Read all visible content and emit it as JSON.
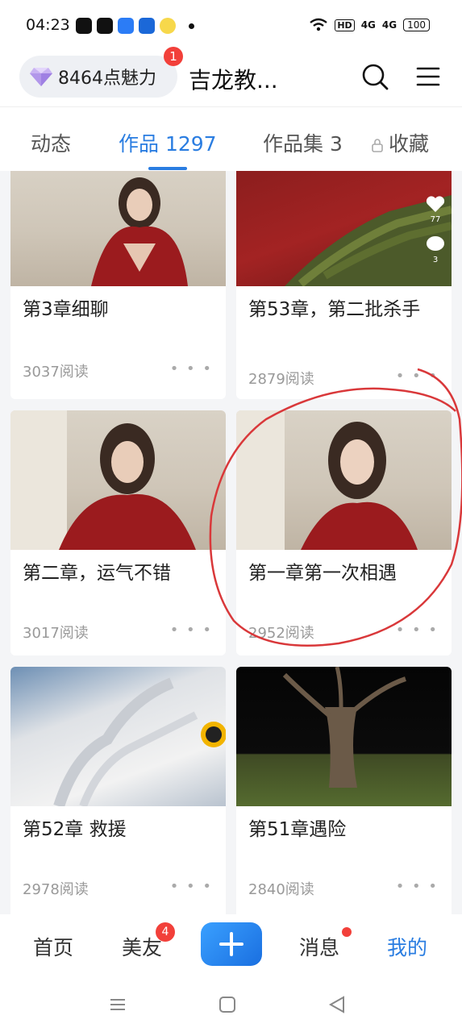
{
  "status_bar": {
    "time": "04:23",
    "hd": "HD",
    "net1": "4G",
    "net2": "4G",
    "battery": "100"
  },
  "header": {
    "charm_text": "8464点魅力",
    "charm_badge": "1",
    "username": "吉龙教...",
    "icons": [
      "diamond-icon",
      "search-icon",
      "menu-icon"
    ]
  },
  "tabs": [
    {
      "label": "动态"
    },
    {
      "label": "作品 1297"
    },
    {
      "label": "作品集 3"
    },
    {
      "label": "收藏"
    }
  ],
  "cards": [
    {
      "title": "第3章细聊",
      "reads": "3037阅读",
      "more": "• • •"
    },
    {
      "title": "第53章，第二批杀手",
      "reads": "2879阅读",
      "more": "• • •",
      "likes": "77",
      "comments": "3"
    },
    {
      "title": "第二章，运气不错",
      "reads": "3017阅读",
      "more": "• • •"
    },
    {
      "title": "第一章第一次相遇",
      "reads": "2952阅读",
      "more": "• • •"
    },
    {
      "title": "第52章 救援",
      "reads": "2978阅读",
      "more": "• • •"
    },
    {
      "title": "第51章遇险",
      "reads": "2840阅读",
      "more": "• • •"
    }
  ],
  "bottom_nav": {
    "home": "首页",
    "friends": "美友",
    "friends_badge": "4",
    "messages": "消息",
    "mine": "我的"
  },
  "colors": {
    "accent": "#2a7de1",
    "badge": "#f2403a",
    "annotation": "#d9383a"
  }
}
